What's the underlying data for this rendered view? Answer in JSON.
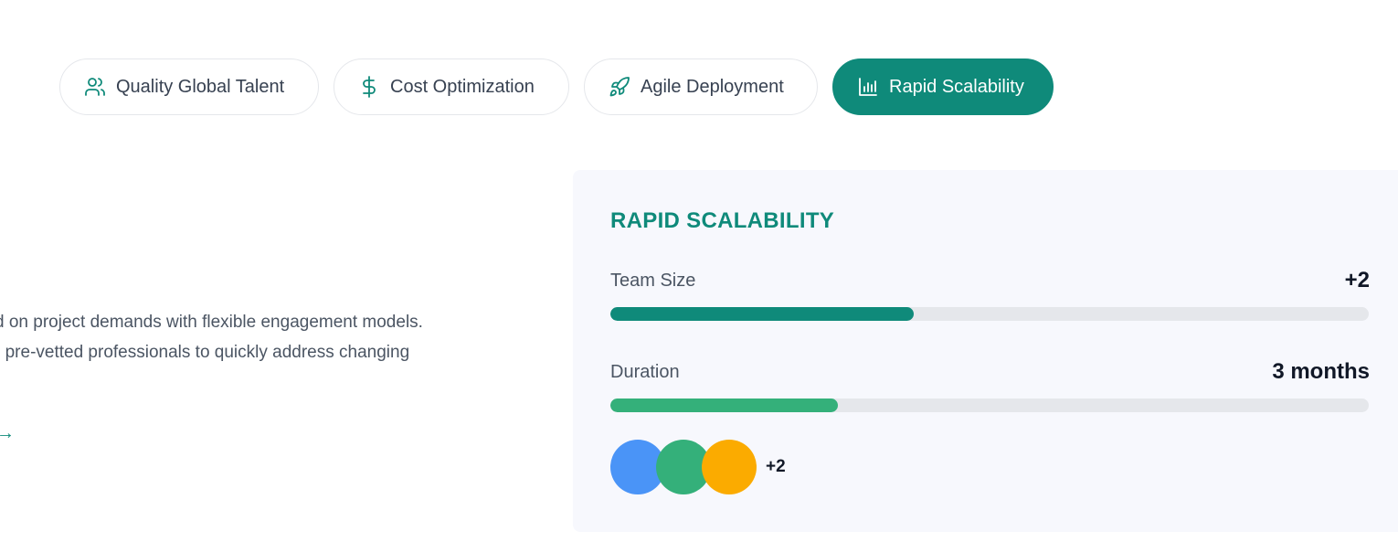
{
  "tabs": [
    {
      "label": "Quality Global Talent",
      "icon": "users-icon",
      "active": false
    },
    {
      "label": "Cost Optimization",
      "icon": "dollar-icon",
      "active": false
    },
    {
      "label": "Agile Deployment",
      "icon": "rocket-icon",
      "active": false
    },
    {
      "label": "Rapid Scalability",
      "icon": "bar-chart-icon",
      "active": true
    }
  ],
  "content": {
    "line1": "d on project demands with flexible engagement models.",
    "line2": ") pre-vetted professionals to quickly address changing",
    "learn_more": "→"
  },
  "panel": {
    "title": "RAPID SCALABILITY",
    "metrics": [
      {
        "label": "Team Size",
        "value": "+2",
        "progress": 0.4,
        "color": "#0f8a7a"
      },
      {
        "label": "Duration",
        "value": "3 months",
        "progress": 0.3,
        "color": "#34b07a"
      }
    ],
    "avatars": [
      {
        "color": "#4a94f7"
      },
      {
        "color": "#34b07a"
      },
      {
        "color": "#fbab00"
      }
    ],
    "avatars_more": "+2"
  },
  "colors": {
    "accent": "#0f8a7a",
    "panel_bg": "#f7f8fd"
  }
}
